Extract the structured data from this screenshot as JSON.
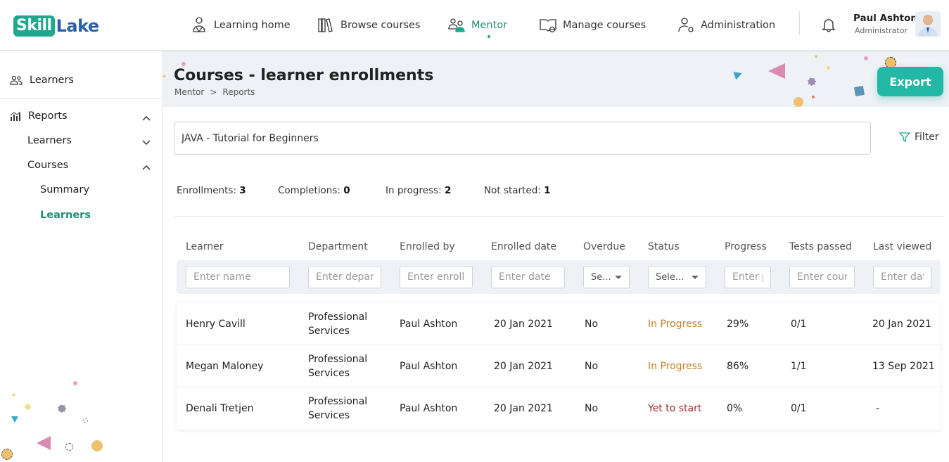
{
  "brand": {
    "logo_box": "Skill",
    "logo_rest": "Lake"
  },
  "nav": {
    "learning_home": "Learning home",
    "browse_courses": "Browse courses",
    "mentor": "Mentor",
    "manage_courses": "Manage courses",
    "administration": "Administration"
  },
  "user": {
    "name": "Paul Ashton",
    "role": "Administrator"
  },
  "sidebar": {
    "learners": "Learners",
    "reports": "Reports",
    "reports_learners": "Learners",
    "courses": "Courses",
    "summary": "Summary",
    "courses_learners": "Learners"
  },
  "page": {
    "title": "Courses - learner enrollments",
    "breadcrumb": [
      "Mentor",
      ">",
      "Reports"
    ],
    "export_label": "Export",
    "search_value": "JAVA - Tutorial for Beginners",
    "filter_label": "Filter"
  },
  "stats": {
    "enrollments_label": "Enrollments:",
    "enrollments": "3",
    "completions_label": "Completions:",
    "completions": "0",
    "in_progress_label": "In progress:",
    "in_progress": "2",
    "not_started_label": "Not started:",
    "not_started": "1"
  },
  "table": {
    "headers": [
      "Learner",
      "Department",
      "Enrolled by",
      "Enrolled date",
      "Overdue",
      "Status",
      "Progress",
      "Tests passed",
      "Last viewed"
    ],
    "filters": {
      "learner": "Enter name",
      "department": "Enter department",
      "enrolled_by": "Enter enrolled by",
      "enrolled_date": "Enter date",
      "overdue": "Se...",
      "status": "Sele...",
      "progress": "Enter progress",
      "tests": "Enter count",
      "last_viewed": "Enter date"
    },
    "rows": [
      {
        "learner": "Henry Cavill",
        "department": "Professional Services",
        "enrolled_by": "Paul Ashton",
        "enrolled_date": "20 Jan 2021",
        "overdue": "No",
        "status": "In Progress",
        "progress": "29%",
        "tests": "0/1",
        "last_viewed": "20 Jan 2021"
      },
      {
        "learner": "Megan Maloney",
        "department": "Professional Services",
        "enrolled_by": "Paul Ashton",
        "enrolled_date": "20 Jan 2021",
        "overdue": "No",
        "status": "In Progress",
        "progress": "86%",
        "tests": "1/1",
        "last_viewed": "13 Sep 2021"
      },
      {
        "learner": "Denali Tretjen",
        "department": "Professional Services",
        "enrolled_by": "Paul Ashton",
        "enrolled_date": "20 Jan 2021",
        "overdue": "No",
        "status": "Yet to start",
        "progress": "0%",
        "tests": "0/1",
        "last_viewed": "-"
      }
    ]
  },
  "colors": {
    "accent": "#1fa88f",
    "export": "#22b8a5",
    "in_progress": "#c47f2a",
    "yet_to_start": "#a32a2a",
    "logo_blue": "#2a5ea8"
  }
}
